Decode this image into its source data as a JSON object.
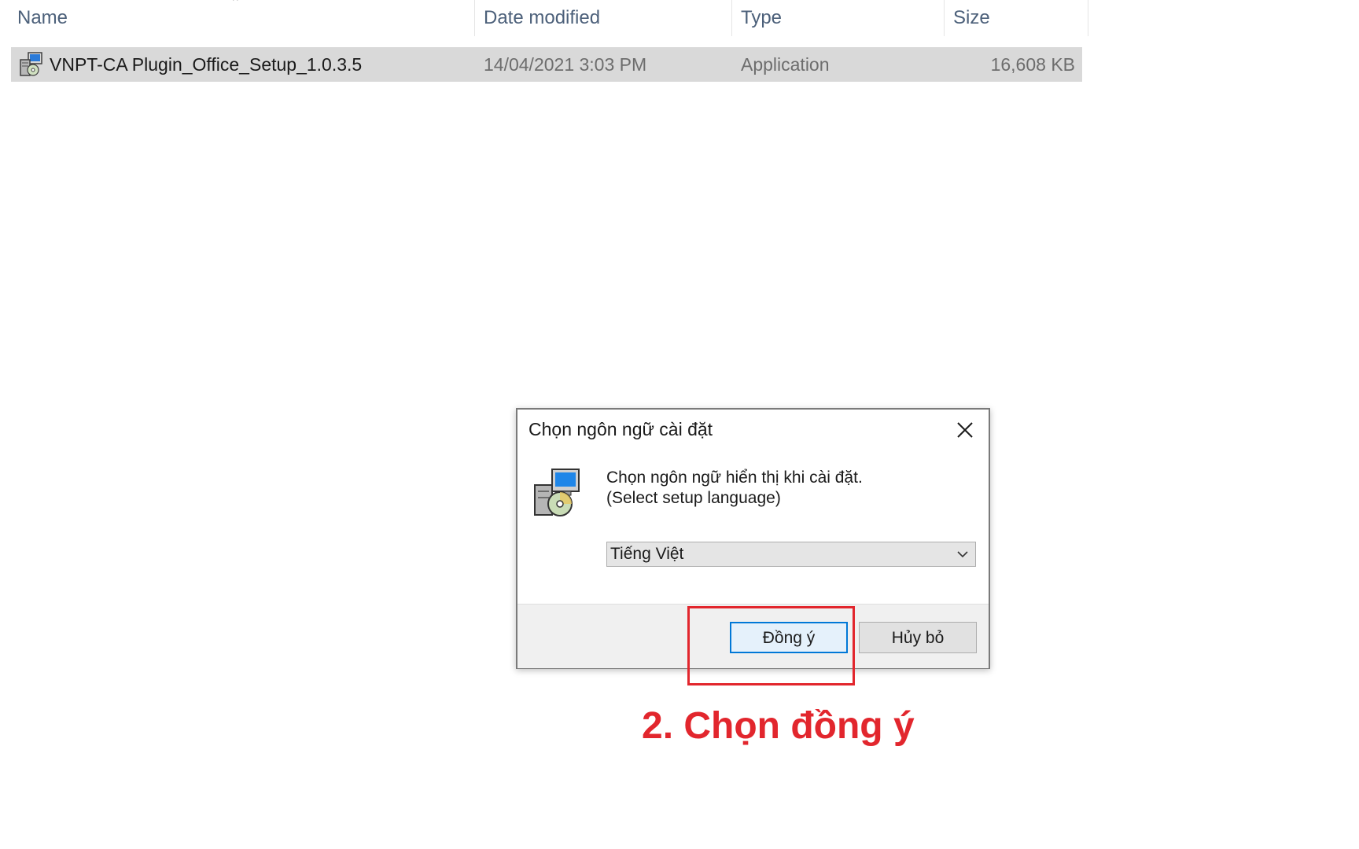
{
  "explorer": {
    "columns": {
      "name": "Name",
      "date_modified": "Date modified",
      "type": "Type",
      "size": "Size"
    },
    "file": {
      "name": "VNPT-CA Plugin_Office_Setup_1.0.3.5",
      "date_modified": "14/04/2021 3:03 PM",
      "type": "Application",
      "size": "16,608 KB",
      "icon": "installer-icon"
    }
  },
  "dialog": {
    "title": "Chọn ngôn ngữ cài đặt",
    "message_line1": "Chọn ngôn ngữ hiển thị khi cài đặt.",
    "message_line2": "(Select setup language)",
    "language_selected": "Tiếng Việt",
    "ok_label": "Đồng ý",
    "cancel_label": "Hủy bỏ"
  },
  "annotation": {
    "text": "2. Chọn đồng ý",
    "color": "#e2262d"
  }
}
